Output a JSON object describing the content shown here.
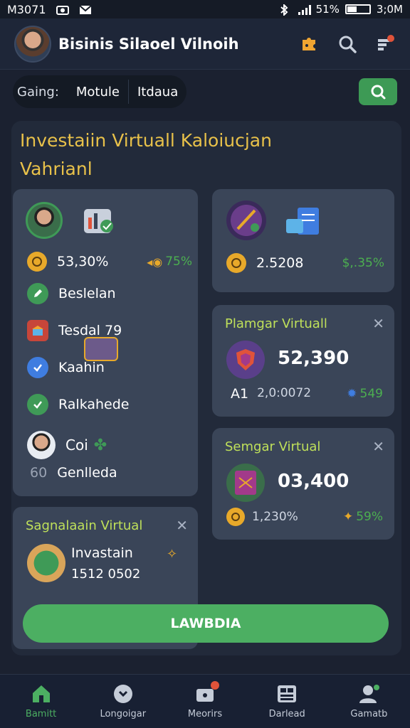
{
  "status_bar": {
    "carrier": "M3071",
    "battery": "51%",
    "time": "3;0M"
  },
  "header": {
    "title": "Bisinis Silaoel Vilnoih"
  },
  "filters": {
    "chip1": "Gaing:",
    "chip2": "Motule",
    "chip3": "Itdaua"
  },
  "main": {
    "title": "Investaiin Virtuall Kaloiucjan Vahrianl"
  },
  "card1": {
    "stat_value": "53,30%",
    "stat_change": "75%",
    "items": [
      {
        "label": "Beslelan",
        "icon": "edit-icon"
      },
      {
        "label": "Tesdal 79",
        "icon": "store-icon"
      },
      {
        "label": "Kaahin",
        "icon": "check-icon"
      },
      {
        "label": "Ralkahede",
        "icon": "check-icon"
      }
    ],
    "person_label": "Coi",
    "footer_num": "60",
    "footer_label": "Genlleda"
  },
  "card2": {
    "value": "2.5208",
    "change": "$,.35%"
  },
  "card3": {
    "title": "Plamgar Virtuall",
    "value": "52,390",
    "sub_label": "A1",
    "sub_value": "2,0:0072",
    "change": "549"
  },
  "card4": {
    "title": "Semgar Virtual",
    "value": "03,400",
    "sub_value": "1,230%",
    "change": "59%"
  },
  "card5": {
    "title": "Sagnalaain Virtual",
    "line1": "Invastain",
    "line2": "1512 0502"
  },
  "cta": {
    "label": "LAWBDIA"
  },
  "nav": [
    {
      "label": "Bamitt",
      "icon": "home-icon"
    },
    {
      "label": "Longoigar",
      "icon": "clock-icon"
    },
    {
      "label": "Meorirs",
      "icon": "briefcase-icon"
    },
    {
      "label": "Darlead",
      "icon": "dashboard-icon"
    },
    {
      "label": "Gamatb",
      "icon": "profile-icon"
    }
  ],
  "colors": {
    "accent_green": "#4caf62",
    "title_gold": "#e8c14a",
    "card_title_lime": "#bfe05a",
    "background": "#1b2130",
    "card": "#3a4558"
  }
}
